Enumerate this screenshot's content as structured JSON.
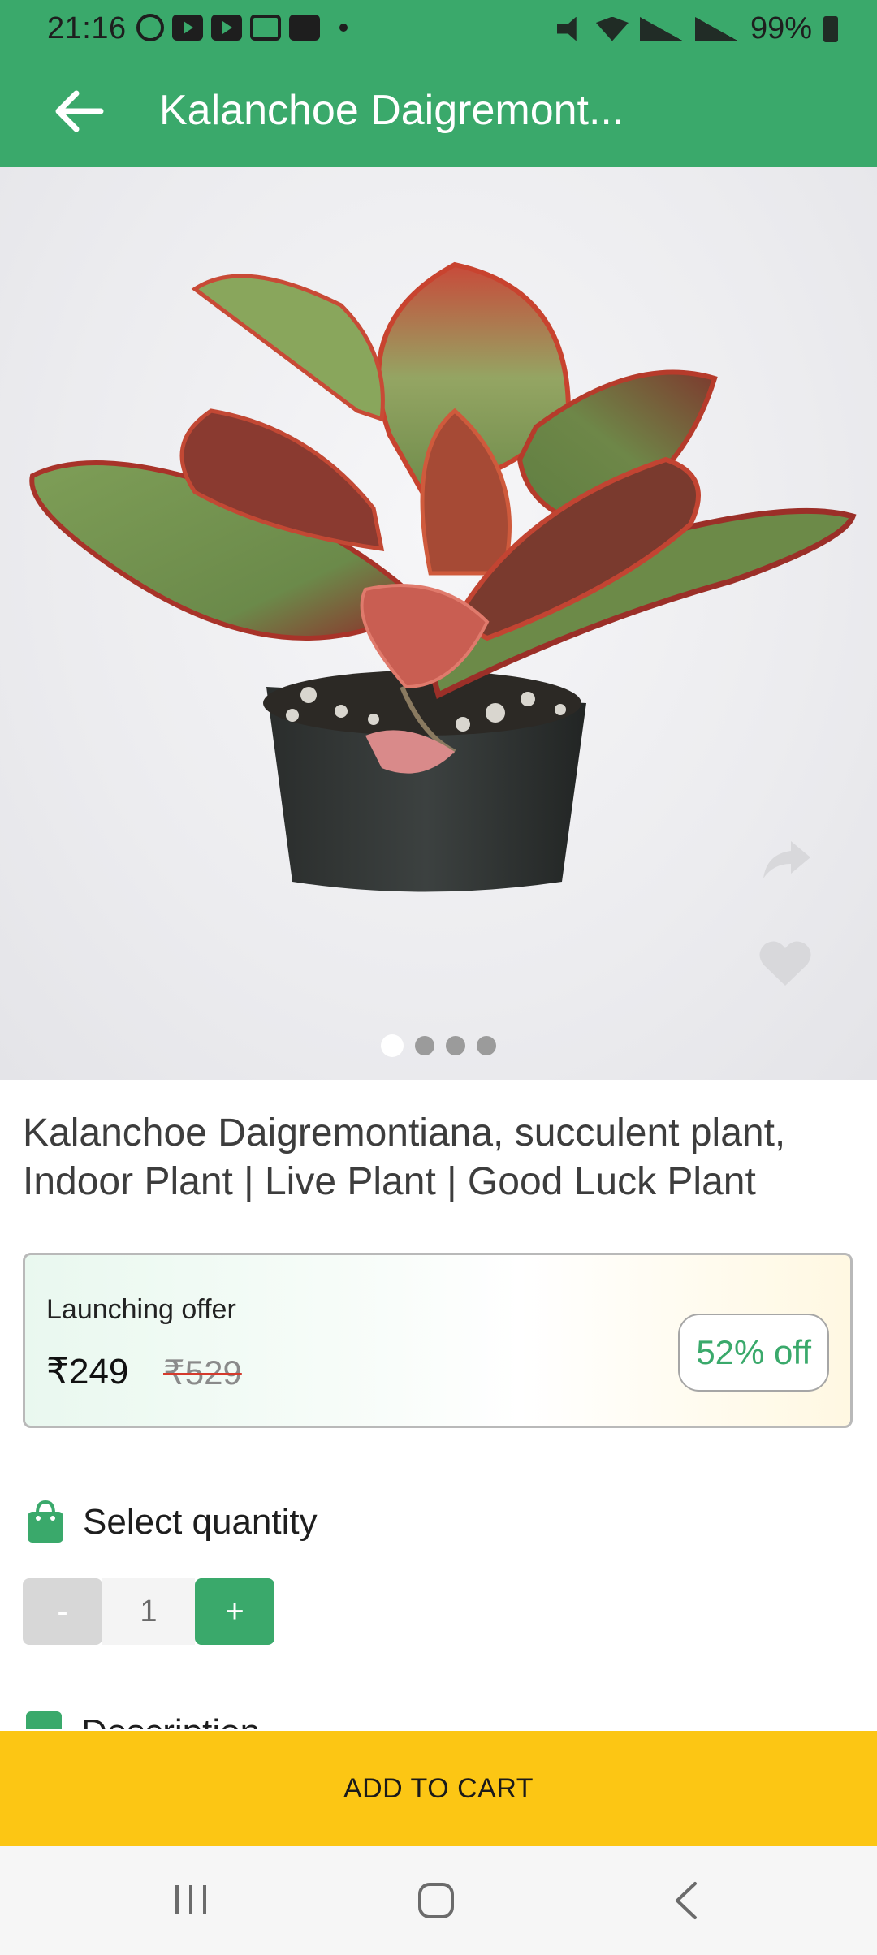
{
  "status_bar": {
    "time": "21:16",
    "battery": "99%",
    "notification_icons": [
      "whatsapp-icon",
      "youtube-icon",
      "youtube-icon",
      "voicemail-icon",
      "gallery-icon",
      "dot-icon"
    ],
    "system_icons": [
      "mute-icon",
      "wifi-icon",
      "volte-lte1-signal-icon",
      "volte-lte2-signal-icon",
      "battery-icon"
    ]
  },
  "app_bar": {
    "title": "Kalanchoe Daigremont...",
    "back_icon": "arrow-left-icon",
    "background": "#3aa96b"
  },
  "gallery": {
    "image_count": 4,
    "active_index": 0,
    "share_icon": "share-icon",
    "favorite_icon": "heart-icon"
  },
  "product": {
    "title": "Kalanchoe Daigremontiana, succulent plant, Indoor Plant | Live Plant | Good Luck Plant"
  },
  "offer": {
    "label": "Launching offer",
    "price": "₹249",
    "mrp": "₹529",
    "discount": "52% off",
    "discount_color": "#3aa96b"
  },
  "quantity": {
    "heading": "Select quantity",
    "icon": "shopping-bag-icon",
    "minus_label": "-",
    "value": "1",
    "plus_label": "+"
  },
  "description": {
    "heading": "Description",
    "icon": "document-icon"
  },
  "cart": {
    "label": "ADD TO CART",
    "color": "#fcc614"
  },
  "nav_bar": {
    "icons": [
      "recent-apps-icon",
      "home-icon",
      "back-icon"
    ]
  }
}
